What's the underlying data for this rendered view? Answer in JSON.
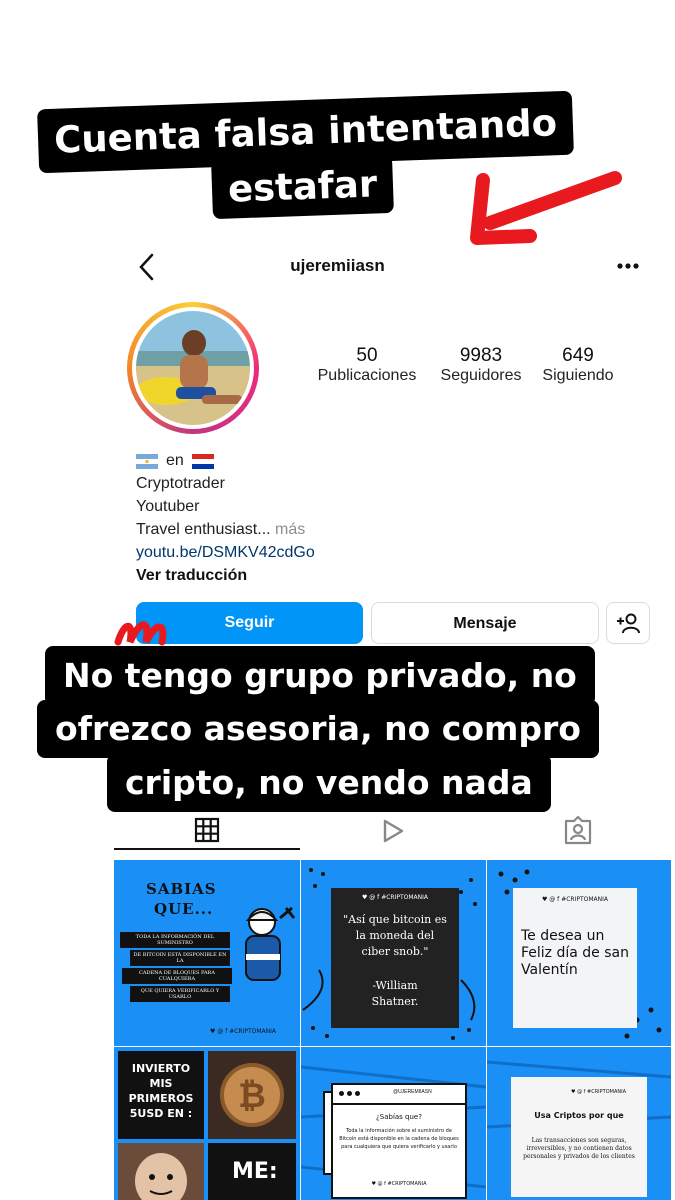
{
  "captions": {
    "top_line1": "Cuenta falsa intentando",
    "top_line2": "estafar",
    "bottom_line1": "No tengo grupo privado, no",
    "bottom_line2": "ofrezco asesoria, no compro",
    "bottom_line3": "cripto, no vendo nada"
  },
  "header": {
    "back_icon": "chevron-left-icon",
    "username": "ujeremiiasn",
    "more_icon": "more-horizontal-icon"
  },
  "stats": [
    {
      "value": "50",
      "label": "Publicaciones"
    },
    {
      "value": "9983",
      "label": "Seguidores"
    },
    {
      "value": "649",
      "label": "Siguiendo"
    }
  ],
  "bio": {
    "flags_connector": "en",
    "line1": "Cryptotrader",
    "line2": "Youtuber",
    "line3": "Travel enthusiast...",
    "more": "más",
    "link": "youtu.be/DSMKV42cdGo",
    "translate": "Ver traducción"
  },
  "buttons": {
    "follow": "Seguir",
    "message": "Mensaje",
    "add_user_icon": "add-user-icon"
  },
  "tabs": [
    "grid-icon",
    "reels-icon",
    "tagged-icon"
  ],
  "posts": {
    "p1_title1": "SABIAS",
    "p1_title2": "QUE...",
    "p1_lines": [
      "TODA LA INFORMACIÓN DEL SUMINISTRO",
      "DE BITCOIN ESTÁ DISPONIBLE EN LA",
      "CADENA DE BLOQUES PARA CUALQUIERA",
      "QUE QUIERA VERIFICARLO Y USARLO"
    ],
    "brand": "♥ @ f #CRIPTOMANIA",
    "p2_quote": "\"Así que bitcoin es la moneda del ciber snob.\"",
    "p2_author": "-William Shatner.",
    "p3_text": "Te desea un Feliz día de san Valentín",
    "p4_text": "INVIERTO MIS PRIMEROS 5USD EN :",
    "p4_me": "ME:",
    "p5_handle": "@UJEREMIIASN",
    "p5_title": "¿Sabías que?",
    "p5_body": "Toda la información sobre el suministro de Bitcoin está disponible en la cadena de bloques para cualquiera que quiera verificarlo y usarlo",
    "p6_title": "Usa Criptos por que",
    "p6_body": "Las transacciones son seguras, irreversibles, y no contienen datos personales y privados de los clientes"
  },
  "colors": {
    "follow_blue": "#0095f6",
    "link_blue": "#00376b",
    "tile_blue": "#1a8ff5",
    "arrow_red": "#e8191f"
  }
}
